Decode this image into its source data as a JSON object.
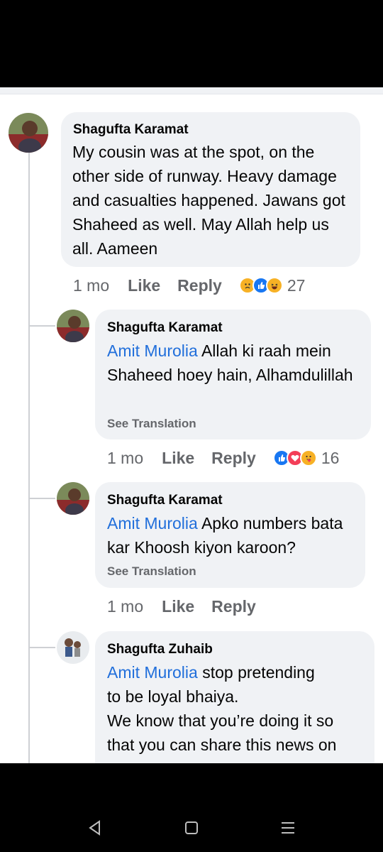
{
  "comments": [
    {
      "author": "Shagufta Karamat",
      "mention": "",
      "text": "My cousin was at the spot, on the other side of runway. Heavy damage and casualties happened. Jawans got Shaheed as well. May Allah help us all. Aameen",
      "time": "1 mo",
      "like_label": "Like",
      "reply_label": "Reply",
      "reactions": [
        "sad-emoji-icon",
        "like-emoji-icon",
        "haha-emoji-icon"
      ],
      "reaction_count": "27"
    },
    {
      "author": "Shagufta Karamat",
      "mention": "Amit Murolia",
      "text": "Allah ki raah mein Shaheed hoey hain, Alhamdulillah",
      "see_translation": "See Translation",
      "time": "1 mo",
      "like_label": "Like",
      "reply_label": "Reply",
      "reactions": [
        "like-emoji-icon",
        "love-emoji-icon",
        "care-emoji-icon"
      ],
      "reaction_count": "16"
    },
    {
      "author": "Shagufta Karamat",
      "mention": "Amit Murolia",
      "text": "Apko numbers bata kar Khoosh kiyon karoon?",
      "see_translation": "See Translation",
      "time": "1 mo",
      "like_label": "Like",
      "reply_label": "Reply"
    },
    {
      "author": "Shagufta Zuhaib",
      "mention": "Amit Murolia",
      "text_line1": "stop pretending",
      "text_line2": "to be loyal bhaiya.",
      "text_line3": "We know that you’re doing it so",
      "text_line4": "that you can share this news on"
    }
  ],
  "colors": {
    "bubble": "#f0f2f5",
    "mention": "#216fdb",
    "meta": "#65676b",
    "like": "#1877f2",
    "love": "#f33e58",
    "haha": "#f7b125"
  },
  "navigation": [
    "back-nav-icon",
    "home-nav-icon",
    "menu-nav-icon"
  ]
}
